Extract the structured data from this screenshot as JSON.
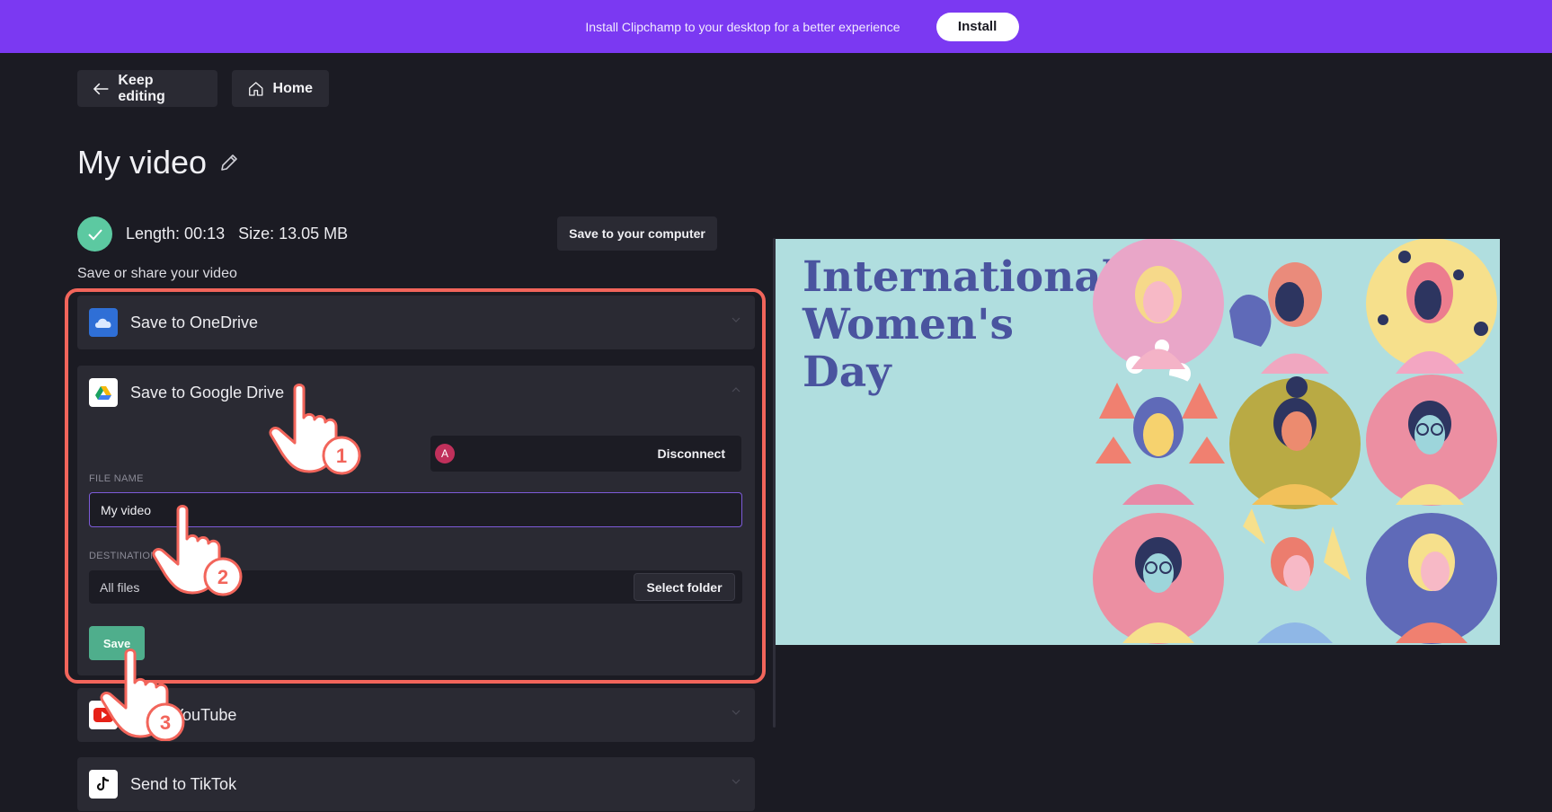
{
  "banner": {
    "text": "Install Clipchamp to your desktop for a better experience",
    "install_label": "Install"
  },
  "nav": {
    "keep_editing": "Keep editing",
    "home": "Home"
  },
  "video": {
    "title": "My video",
    "length": "Length: 00:13",
    "size": "Size: 13.05 MB"
  },
  "save_computer": "Save to your computer",
  "share_label": "Save or share your video",
  "destinations": {
    "onedrive": "Save to OneDrive",
    "google_drive": "Save to Google Drive",
    "youtube": "to YouTube",
    "tiktok": "Send to TikTok"
  },
  "gdrive": {
    "account_initial": "A",
    "disconnect": "Disconnect",
    "file_name_label": "FILE NAME",
    "file_name_value": "My video",
    "destination_label": "DESTINATION",
    "destination_value": "All files",
    "select_folder": "Select folder",
    "save": "Save"
  },
  "preview": {
    "title": "International\nWomen's\nDay"
  },
  "steps": [
    "1",
    "2",
    "3"
  ],
  "colors": {
    "banner": "#7b39f2",
    "accent_green": "#4fae8c",
    "highlight": "#f2655b",
    "preview_bg": "#b0dedf"
  }
}
